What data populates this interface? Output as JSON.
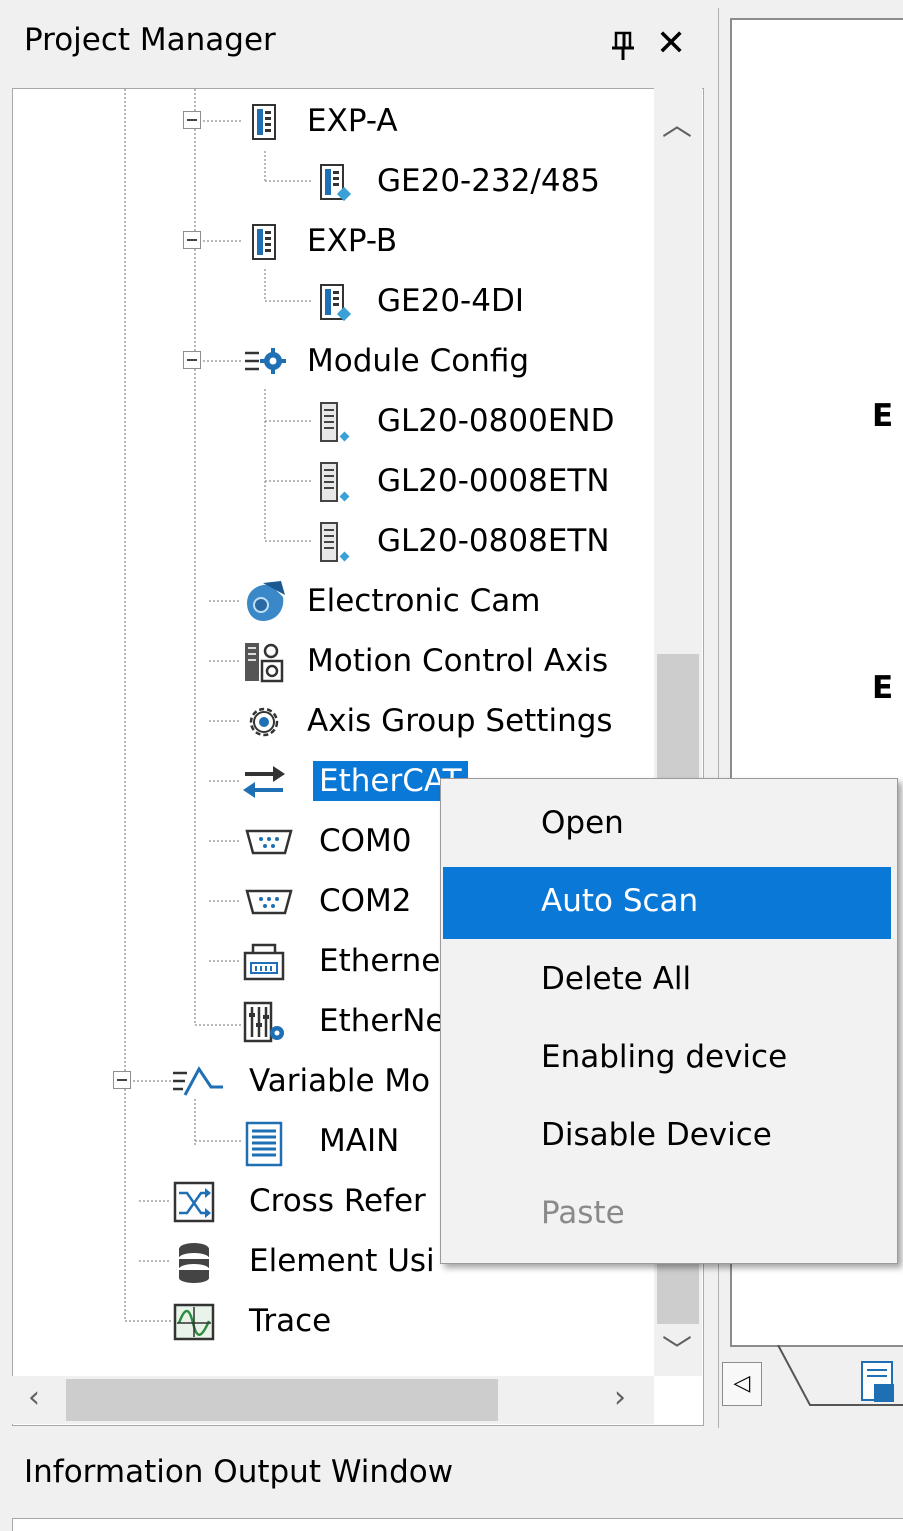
{
  "project_manager": {
    "title": "Project Manager",
    "tree": [
      {
        "label": "EXP-A",
        "icon": "expansion-module-icon"
      },
      {
        "label": "GE20-232/485",
        "icon": "expansion-card-icon"
      },
      {
        "label": "EXP-B",
        "icon": "expansion-module-icon"
      },
      {
        "label": "GE20-4DI",
        "icon": "expansion-card-icon"
      },
      {
        "label": "Module Config",
        "icon": "module-config-icon"
      },
      {
        "label": "GL20-0800END",
        "icon": "io-module-icon"
      },
      {
        "label": "GL20-0008ETN",
        "icon": "io-module-icon"
      },
      {
        "label": "GL20-0808ETN",
        "icon": "io-module-icon"
      },
      {
        "label": "Electronic Cam",
        "icon": "cam-icon"
      },
      {
        "label": "Motion Control Axis",
        "icon": "motion-axis-icon"
      },
      {
        "label": "Axis Group Settings",
        "icon": "gear-icon"
      },
      {
        "label": "EtherCAT",
        "icon": "ethercat-arrows-icon"
      },
      {
        "label": "COM0",
        "icon": "serial-port-icon"
      },
      {
        "label": "COM2",
        "icon": "serial-port-icon"
      },
      {
        "label": "Etherne",
        "icon": "ethernet-icon"
      },
      {
        "label": "EtherNe",
        "icon": "ethernet-ip-icon"
      },
      {
        "label": "Variable Mo",
        "icon": "variable-monitor-icon"
      },
      {
        "label": "MAIN",
        "icon": "document-icon"
      },
      {
        "label": "Cross Refer",
        "icon": "cross-reference-icon"
      },
      {
        "label": "Element Usi",
        "icon": "database-icon"
      },
      {
        "label": "Trace",
        "icon": "trace-icon"
      }
    ]
  },
  "editor": {
    "label_1": "E",
    "label_2": "E"
  },
  "context_menu": {
    "items": [
      {
        "label": "Open",
        "state": "normal"
      },
      {
        "label": "Auto Scan",
        "state": "highlighted"
      },
      {
        "label": "Delete All",
        "state": "normal"
      },
      {
        "label": "Enabling device",
        "state": "normal"
      },
      {
        "label": "Disable Device",
        "state": "normal"
      },
      {
        "label": "Paste",
        "state": "disabled"
      }
    ]
  },
  "info_window": {
    "title": "Information Output Window"
  },
  "colors": {
    "selection": "#0a78d7",
    "panel_bg": "#f0f0f0",
    "tree_bg": "#ffffff",
    "menu_bg": "#f2f2f2",
    "disabled_text": "#8a8a8a"
  }
}
